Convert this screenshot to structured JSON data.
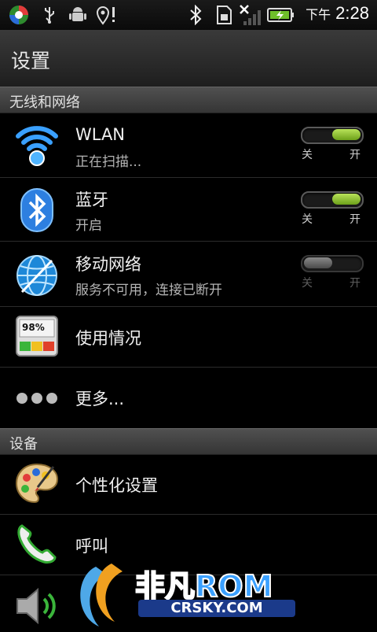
{
  "status": {
    "ampm": "下午",
    "time": "2:28"
  },
  "header": {
    "title": "设置"
  },
  "sections": [
    {
      "label": "无线和网络"
    },
    {
      "label": "设备"
    }
  ],
  "wireless": {
    "wlan": {
      "title": "WLAN",
      "subtitle": "正在扫描...",
      "off": "关",
      "on": "开"
    },
    "bluetooth": {
      "title": "蓝牙",
      "subtitle": "开启",
      "off": "关",
      "on": "开"
    },
    "mobile": {
      "title": "移动网络",
      "subtitle": "服务不可用，连接已断开",
      "off": "关",
      "on": "开"
    },
    "usage": {
      "title": "使用情况",
      "icon_text": "98%"
    },
    "more": {
      "title": "更多..."
    }
  },
  "device": {
    "personalize": {
      "title": "个性化设置"
    },
    "call": {
      "title": "呼叫"
    }
  },
  "watermark": {
    "brand": "非凡ROM",
    "site": "CRSKY.COM"
  },
  "colors": {
    "toggle_on": "#8cc63f",
    "accent_blue": "#3aa0ff"
  }
}
